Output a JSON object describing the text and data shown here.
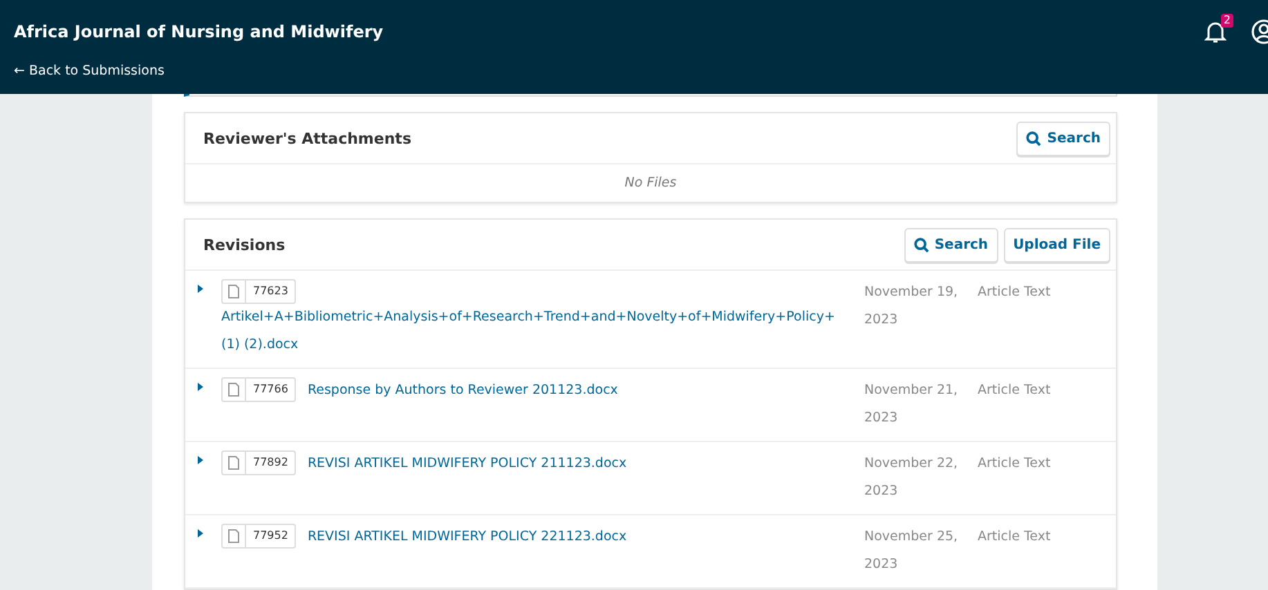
{
  "header": {
    "title": "Africa Journal of Nursing and Midwifery",
    "back_link": "← Back to Submissions",
    "notifications_count": "2"
  },
  "reviewer_attachments": {
    "title": "Reviewer's Attachments",
    "buttons": [
      "Search"
    ],
    "empty_text": "No Files"
  },
  "revisions": {
    "title": "Revisions",
    "buttons": [
      "Search",
      "Upload File"
    ],
    "rows": [
      {
        "id": "77623",
        "name": "Artikel+A+Bibliometric+Analysis+of+Research+Trend+and+Novelty+of+Midwifery+Policy+(1) (2).docx",
        "date": "November 19, 2023",
        "type": "Article Text",
        "expanded": false
      },
      {
        "id": "77766",
        "name": "Response by Authors to Reviewer 201123.docx",
        "date": "November 21, 2023",
        "type": "Article Text",
        "expanded": false
      },
      {
        "id": "77892",
        "name": "REVISI ARTIKEL MIDWIFERY POLICY 211123.docx",
        "date": "November 22, 2023",
        "type": "Article Text",
        "expanded": false
      },
      {
        "id": "77952",
        "name": "REVISI ARTIKEL MIDWIFERY POLICY 221123.docx",
        "date": "November 25, 2023",
        "type": "Article Text",
        "expanded": false
      }
    ]
  }
}
